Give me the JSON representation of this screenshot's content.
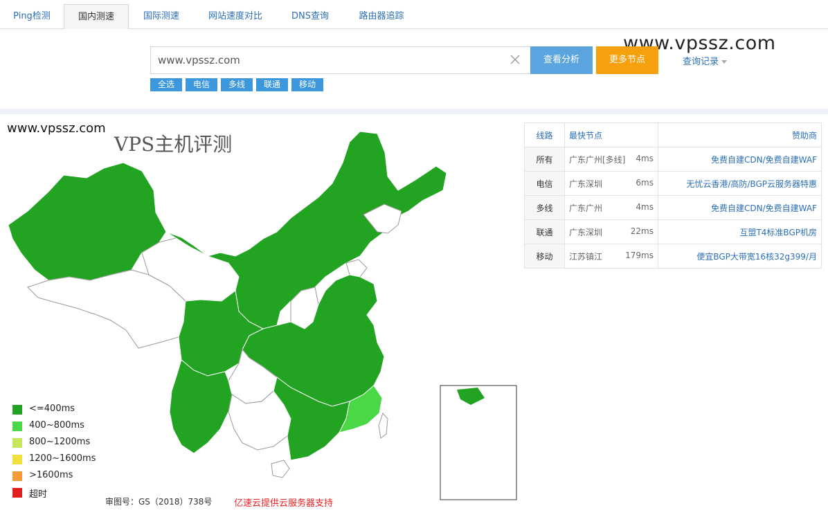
{
  "tabs": [
    {
      "label": "Ping检测",
      "active": false
    },
    {
      "label": "国内测速",
      "active": true
    },
    {
      "label": "国际测速",
      "active": false
    },
    {
      "label": "网站速度对比",
      "active": false
    },
    {
      "label": "DNS查询",
      "active": false
    },
    {
      "label": "路由器追踪",
      "active": false
    }
  ],
  "search": {
    "value": "www.vpssz.com",
    "analyze_label": "查看分析",
    "more_label": "更多节点",
    "history_label": "查询记录"
  },
  "watermark_top": "www.vpssz.com",
  "filters": [
    "全选",
    "电信",
    "多线",
    "联通",
    "移动"
  ],
  "map": {
    "watermark_url": "www.vpssz.com",
    "watermark_title": "VPS主机评测",
    "legend": [
      {
        "label": "<=400ms",
        "color": "#22a321"
      },
      {
        "label": "400~800ms",
        "color": "#4ad847"
      },
      {
        "label": "800~1200ms",
        "color": "#c6e85a"
      },
      {
        "label": "1200~1600ms",
        "color": "#f0e040"
      },
      {
        "label": ">1600ms",
        "color": "#f39a3a"
      },
      {
        "label": "超时",
        "color": "#e02020"
      }
    ],
    "note": "审图号：GS（2018）738号",
    "credit": "亿速云提供云服务器支持"
  },
  "result_table": {
    "headers": [
      "线路",
      "最快节点",
      "赞助商"
    ],
    "rows": [
      {
        "line": "所有",
        "node": "广东广州[多线]",
        "ms": "4ms",
        "sponsor": "免费自建CDN/免费自建WAF"
      },
      {
        "line": "电信",
        "node": "广东深圳",
        "ms": "6ms",
        "sponsor": "无忧云香港/高防/BGP云服务器特惠"
      },
      {
        "line": "多线",
        "node": "广东广州",
        "ms": "4ms",
        "sponsor": "免费自建CDN/免费自建WAF"
      },
      {
        "line": "联通",
        "node": "广东深圳",
        "ms": "22ms",
        "sponsor": "互盟T4标准BGP机房"
      },
      {
        "line": "移动",
        "node": "江苏镇江",
        "ms": "179ms",
        "sponsor": "便宜BGP大带宽16核32g399/月"
      }
    ]
  }
}
